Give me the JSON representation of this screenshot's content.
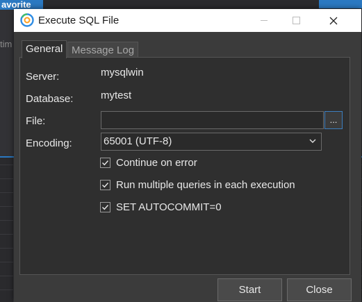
{
  "background_app": {
    "header_label": "avorite",
    "side_label": "tim"
  },
  "dialog": {
    "title": "Execute SQL File",
    "close_glyph": "✕"
  },
  "tabs": [
    {
      "label": "General",
      "active": true
    },
    {
      "label": "Message Log",
      "active": false
    }
  ],
  "form": {
    "server_label": "Server:",
    "server_value": "mysqlwin",
    "database_label": "Database:",
    "database_value": "mytest",
    "file_label": "File:",
    "file_value": "",
    "browse_label": "...",
    "encoding_label": "Encoding:",
    "encoding_value": "65001 (UTF-8)"
  },
  "options": [
    {
      "label": "Continue on error",
      "checked": true
    },
    {
      "label": "Run multiple queries in each execution",
      "checked": true
    },
    {
      "label": "SET AUTOCOMMIT=0",
      "checked": true
    }
  ],
  "buttons": {
    "start": "Start",
    "close": "Close"
  },
  "colors": {
    "accent": "#2b79c2",
    "dialog_bg": "#3b3b3b",
    "panel_bg": "#2f2f2f"
  }
}
